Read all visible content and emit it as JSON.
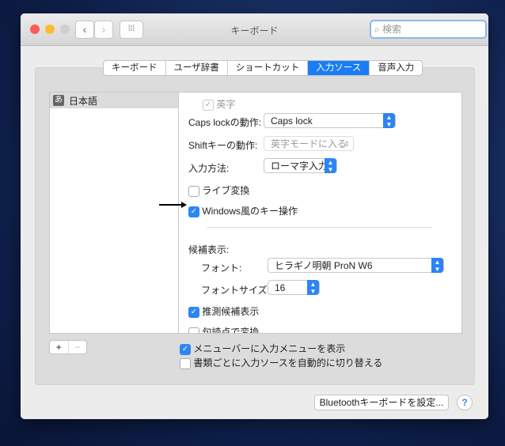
{
  "window": {
    "title": "キーボード",
    "search_placeholder": "検索"
  },
  "tabs": [
    {
      "label": "キーボード"
    },
    {
      "label": "ユーザ辞書"
    },
    {
      "label": "ショートカット"
    },
    {
      "label": "入力ソース",
      "selected": true
    },
    {
      "label": "音声入力"
    }
  ],
  "sources": [
    {
      "icon": "あ",
      "label": "日本語"
    }
  ],
  "settings": {
    "eiji": {
      "label": "英字",
      "checked": true
    },
    "caps": {
      "label": "Caps lockの動作:",
      "value": "Caps lock"
    },
    "shift": {
      "label": "Shiftキーの動作:",
      "value": "英字モードに入る"
    },
    "method": {
      "label": "入力方法:",
      "value": "ローマ字入力"
    },
    "live": {
      "label": "ライブ変換",
      "checked": false
    },
    "windows": {
      "label": "Windows風のキー操作",
      "checked": true
    },
    "candidates": "候補表示:",
    "font": {
      "label": "フォント:",
      "value": "ヒラギノ明朝 ProN W6"
    },
    "size": {
      "label": "フォントサイズ:",
      "value": "16"
    },
    "predict": {
      "label": "推測候補表示",
      "checked": true
    },
    "punct": {
      "label": "句読点で変換",
      "checked": false
    }
  },
  "bottom": {
    "add": "+",
    "remove": "−",
    "show_menu": {
      "label": "メニューバーに入力メニューを表示",
      "checked": true
    },
    "auto_switch": {
      "label": "書類ごとに入力ソースを自動的に切り替える",
      "checked": false
    },
    "bluetooth": "Bluetoothキーボードを設定...",
    "help": "?"
  }
}
